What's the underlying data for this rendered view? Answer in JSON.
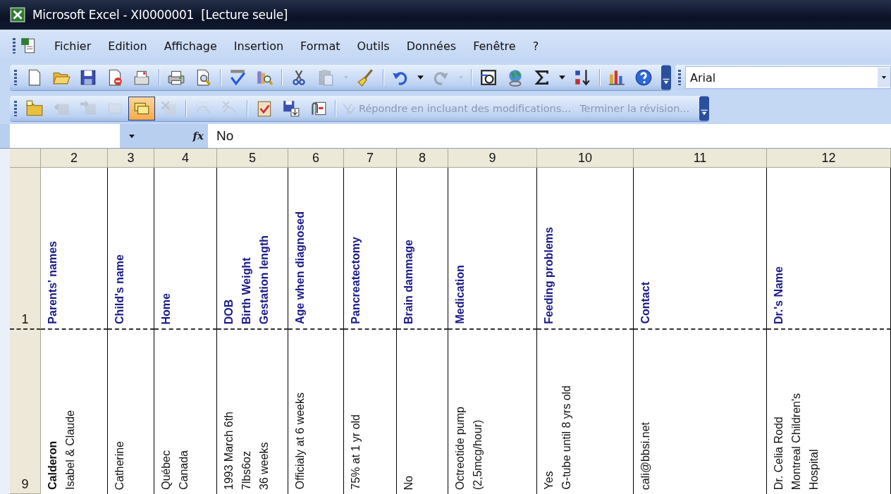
{
  "window": {
    "title": "Microsoft Excel - XI0000001  [Lecture seule]"
  },
  "menu_bar": {
    "items": [
      {
        "label": "Fichier"
      },
      {
        "label": "Edition"
      },
      {
        "label": "Affichage"
      },
      {
        "label": "Insertion"
      },
      {
        "label": "Format"
      },
      {
        "label": "Outils"
      },
      {
        "label": "Données"
      },
      {
        "label": "Fenêtre"
      },
      {
        "label": "?"
      }
    ]
  },
  "standard_toolbar": {
    "items": [
      {
        "kind": "button",
        "disabled": false
      },
      {
        "kind": "button",
        "disabled": false
      },
      {
        "kind": "button",
        "disabled": false
      },
      {
        "kind": "button",
        "disabled": false
      },
      {
        "kind": "button",
        "disabled": false
      },
      {
        "kind": "separator"
      },
      {
        "kind": "button",
        "disabled": false
      },
      {
        "kind": "button",
        "disabled": false
      },
      {
        "kind": "separator"
      },
      {
        "kind": "button",
        "disabled": false
      },
      {
        "kind": "button",
        "disabled": false
      },
      {
        "kind": "separator"
      },
      {
        "kind": "button",
        "disabled": false
      },
      {
        "kind": "button",
        "disabled": true
      },
      {
        "kind": "dropdown",
        "disabled": true
      },
      {
        "kind": "button",
        "disabled": false
      },
      {
        "kind": "separator"
      },
      {
        "kind": "button",
        "disabled": false
      },
      {
        "kind": "dropdown",
        "disabled": false
      },
      {
        "kind": "button",
        "disabled": true
      },
      {
        "kind": "dropdown",
        "disabled": true
      },
      {
        "kind": "separator"
      },
      {
        "kind": "button",
        "disabled": false
      },
      {
        "kind": "button",
        "disabled": false
      },
      {
        "kind": "button",
        "disabled": false
      },
      {
        "kind": "dropdown",
        "disabled": false
      },
      {
        "kind": "button",
        "disabled": false
      },
      {
        "kind": "separator"
      },
      {
        "kind": "button",
        "disabled": false
      },
      {
        "kind": "button",
        "disabled": false
      }
    ],
    "font_box": {
      "value": "Arial"
    }
  },
  "reviewing_toolbar": {
    "items": [
      {
        "kind": "button",
        "disabled": false,
        "selected": false
      },
      {
        "kind": "button",
        "disabled": true,
        "selected": false
      },
      {
        "kind": "button",
        "disabled": true,
        "selected": false
      },
      {
        "kind": "button",
        "disabled": true,
        "selected": false
      },
      {
        "kind": "button",
        "disabled": false,
        "selected": true
      },
      {
        "kind": "button",
        "disabled": true,
        "selected": false
      },
      {
        "kind": "separator"
      },
      {
        "kind": "button",
        "disabled": true,
        "selected": false
      },
      {
        "kind": "button",
        "disabled": true,
        "selected": false
      },
      {
        "kind": "separator"
      },
      {
        "kind": "button",
        "disabled": false,
        "selected": false
      },
      {
        "kind": "button",
        "disabled": false,
        "selected": false
      },
      {
        "kind": "button",
        "disabled": false,
        "selected": false
      },
      {
        "kind": "separator"
      },
      {
        "kind": "text",
        "label": "Répondre en incluant des modifications...",
        "disabled": true
      },
      {
        "kind": "text",
        "label": "Terminer la révision...",
        "disabled": true
      }
    ]
  },
  "formula_bar": {
    "function_label": "fx",
    "content": "No"
  },
  "sheet": {
    "columns": [
      {
        "label": "2"
      },
      {
        "label": "3"
      },
      {
        "label": "4"
      },
      {
        "label": "5"
      },
      {
        "label": "6"
      },
      {
        "label": "7"
      },
      {
        "label": "8"
      },
      {
        "label": "9"
      },
      {
        "label": "10"
      },
      {
        "label": "11"
      },
      {
        "label": "12"
      }
    ],
    "rows": [
      {
        "label": "1",
        "kind": "header",
        "page_break_after": true,
        "cells": [
          "Parents' names",
          "Child's name",
          "Home",
          "DOB\nBirth Weight\nGestation length",
          "Age when diagnosed",
          "Pancreatectomy",
          "Brain dammage",
          "Medication",
          "Feeding problems",
          "Contact",
          "Dr.'s Name"
        ]
      },
      {
        "label": "9",
        "kind": "data",
        "page_break_after": false,
        "cells": [
          "**Calderon**\nIsabel & Claude",
          "Catherine",
          "Québec\nCanada",
          "1993 March 6th\n7lbs6oz\n36 weeks",
          "Officialy at 6 weeks",
          "75% at 1 yr old",
          "No",
          "Octreotide pump\n(2,5mcg/hour)",
          "Yes\nG-tube until 8 yrs old",
          "cali@bbsi.net",
          "Dr. Celia Rodd\nMontreal Children's\nHospital"
        ]
      }
    ]
  }
}
